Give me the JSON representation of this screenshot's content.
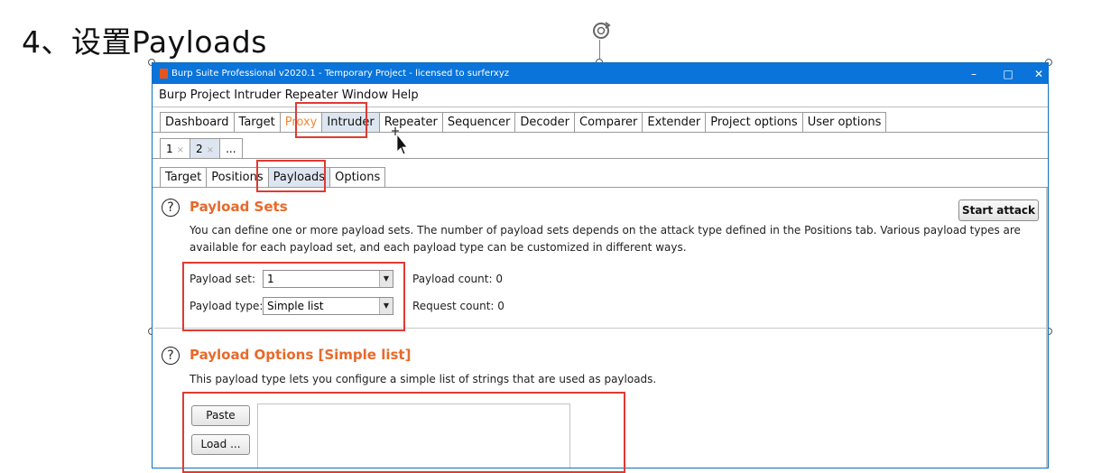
{
  "slide": {
    "heading": "4、设置Payloads"
  },
  "window": {
    "title": "Burp Suite Professional v2020.1 - Temporary Project - licensed to surferxyz",
    "controls": {
      "minimize": "–",
      "maximize": "□",
      "close": "✕"
    }
  },
  "menu": [
    "Burp",
    "Project",
    "Intruder",
    "Repeater",
    "Window",
    "Help"
  ],
  "main_tabs": [
    "Dashboard",
    "Target",
    "Proxy",
    "Intruder",
    "Repeater",
    "Sequencer",
    "Decoder",
    "Comparer",
    "Extender",
    "Project options",
    "User options"
  ],
  "attack_tabs": [
    {
      "label": "1",
      "close": "×"
    },
    {
      "label": "2",
      "close": "×"
    },
    {
      "label": "...",
      "close": ""
    }
  ],
  "sub_tabs": [
    "Target",
    "Positions",
    "Payloads",
    "Options"
  ],
  "payload_sets": {
    "help": "?",
    "title": "Payload Sets",
    "description_line1": "You can define one or more payload sets. The number of payload sets depends on the attack type defined in the Positions tab. Various payload types are",
    "description_line2": "available for each payload set, and each payload type can be customized in different ways.",
    "start_attack": "Start attack",
    "set_label": "Payload set:",
    "set_value": "1",
    "type_label": "Payload type:",
    "type_value": "Simple list",
    "payload_count": "Payload count: 0",
    "request_count": "Request count: 0",
    "arrow": "▼"
  },
  "payload_options": {
    "help": "?",
    "title": "Payload Options [Simple list]",
    "description": "This payload type lets you configure a simple list of strings that are used as payloads.",
    "paste": "Paste",
    "load": "Load ..."
  },
  "colors": {
    "accent": "#e8692a",
    "highlight": "#e03a32",
    "titlebar": "#0a74da"
  }
}
